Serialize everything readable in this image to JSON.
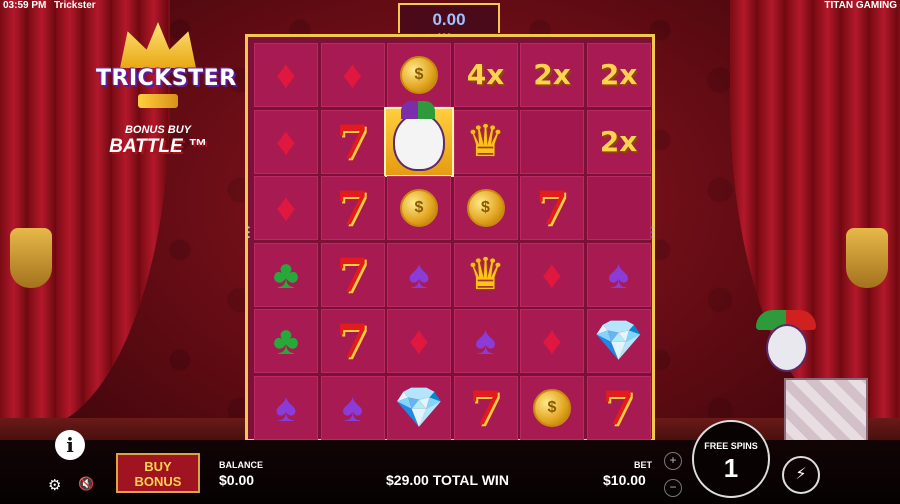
{
  "status_bar": {
    "time": "03:59 PM",
    "game_name": "Trickster",
    "studio": "TITAN GAMING"
  },
  "logo": {
    "title": "TRICKSTER",
    "subtitle_top": "BONUS BUY",
    "subtitle_bottom": "BATTLE ™"
  },
  "win_display": {
    "value": "0.00"
  },
  "grid": {
    "rows": [
      [
        {
          "type": "gem",
          "color": "red"
        },
        {
          "type": "gem",
          "color": "red"
        },
        {
          "type": "coin"
        },
        {
          "type": "multiplier",
          "text": "4x"
        },
        {
          "type": "multiplier",
          "text": "2x"
        },
        {
          "type": "multiplier",
          "text": "2x"
        }
      ],
      [
        {
          "type": "gem",
          "color": "red"
        },
        {
          "type": "seven"
        },
        {
          "type": "joker"
        },
        {
          "type": "crown"
        },
        {
          "type": "empty"
        },
        {
          "type": "multiplier",
          "text": "2x"
        }
      ],
      [
        {
          "type": "gem",
          "color": "red"
        },
        {
          "type": "seven"
        },
        {
          "type": "coin"
        },
        {
          "type": "coin"
        },
        {
          "type": "seven"
        },
        {
          "type": "empty"
        }
      ],
      [
        {
          "type": "club",
          "color": "green"
        },
        {
          "type": "seven"
        },
        {
          "type": "spade",
          "color": "purple"
        },
        {
          "type": "crown"
        },
        {
          "type": "gem",
          "color": "red"
        },
        {
          "type": "spade",
          "color": "purple"
        }
      ],
      [
        {
          "type": "club",
          "color": "green"
        },
        {
          "type": "seven"
        },
        {
          "type": "gem",
          "color": "red"
        },
        {
          "type": "spade",
          "color": "purple"
        },
        {
          "type": "gem",
          "color": "red"
        },
        {
          "type": "diamond",
          "color": "white"
        }
      ],
      [
        {
          "type": "spade",
          "color": "purple"
        },
        {
          "type": "spade",
          "color": "purple"
        },
        {
          "type": "diamond",
          "color": "white"
        },
        {
          "type": "seven"
        },
        {
          "type": "coin"
        },
        {
          "type": "seven"
        }
      ]
    ]
  },
  "controls": {
    "buy_bonus_line1": "BUY",
    "buy_bonus_line2": "BONUS",
    "balance_label": "BALANCE",
    "balance_value": "$0.00",
    "total_win": "$29.00 TOTAL WIN",
    "bet_label": "BET",
    "bet_value": "$10.00",
    "free_spins_label": "FREE SPINS",
    "free_spins_value": "1",
    "plus": "+",
    "minus": "−"
  },
  "colors": {
    "frame_gold": "#f2c94c",
    "board_magenta": "#a81a52",
    "curtain_red": "#b3182a"
  }
}
